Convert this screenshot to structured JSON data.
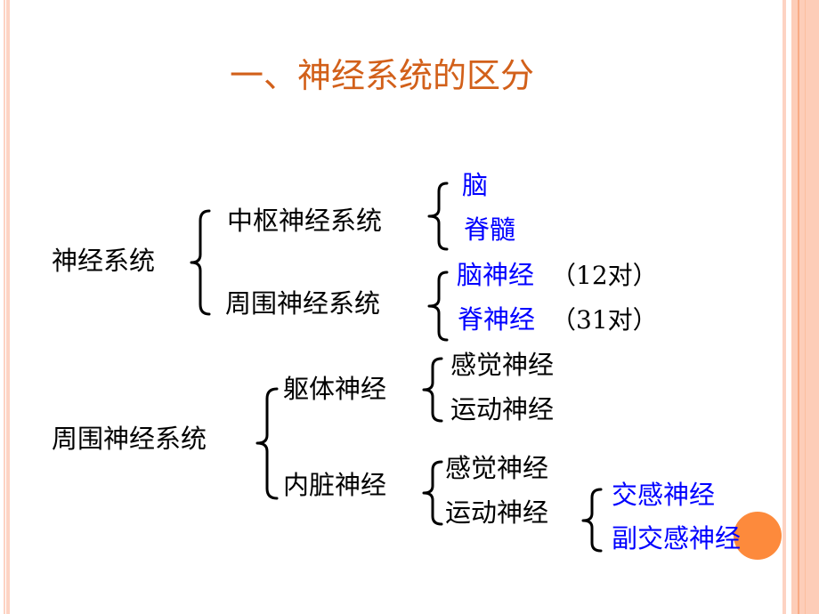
{
  "slide": {
    "title": "一、神经系统的区分",
    "colors": {
      "title": "#d2601a",
      "highlight_text": "#0000ff",
      "body_text": "#000000",
      "border_stripe_light": "#fdd3c3",
      "border_stripe_dark": "#f9ab85",
      "marker_circle": "#fd8a3c"
    },
    "tree1": {
      "root": "神经系统",
      "branches": [
        {
          "label": "中枢神经系统",
          "children": [
            {
              "name": "脑",
              "note": ""
            },
            {
              "name": "脊髓",
              "note": ""
            }
          ]
        },
        {
          "label": "周围神经系统",
          "children": [
            {
              "name": "脑神经",
              "note": "（12对）"
            },
            {
              "name": "脊神经",
              "note": "（31对）"
            }
          ]
        }
      ]
    },
    "tree2": {
      "root": "周围神经系统",
      "branches": [
        {
          "label": "躯体神经",
          "children": [
            "感觉神经",
            "运动神经"
          ]
        },
        {
          "label": "内脏神经",
          "children": [
            "感觉神经",
            "运动神经"
          ],
          "subdivision": [
            "交感神经",
            "副交感神经"
          ]
        }
      ]
    }
  }
}
